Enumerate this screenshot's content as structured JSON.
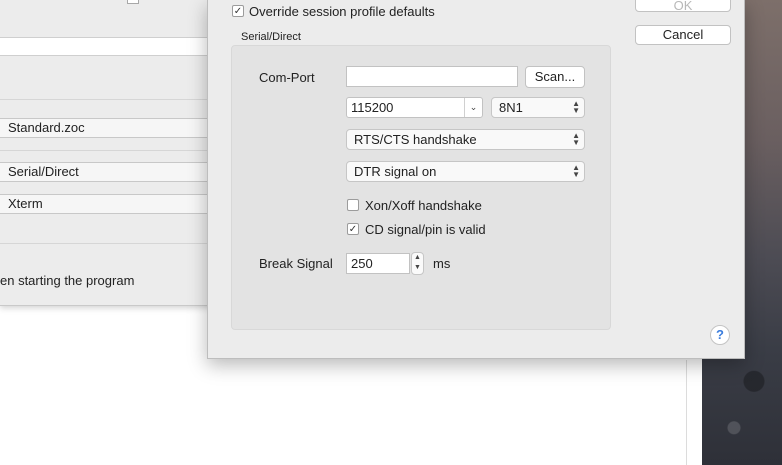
{
  "background_window": {
    "fields": [
      "Standard.zoc",
      "Serial/Direct",
      "Xterm"
    ],
    "partial_text": "en starting the program"
  },
  "sheet": {
    "override_label": "Override session profile defaults",
    "override_checked": "✓",
    "ok_label": "OK",
    "cancel_label": "Cancel",
    "group_title": "Serial/Direct",
    "com_port": {
      "label": "Com-Port",
      "value": "",
      "scan_label": "Scan..."
    },
    "baud": "115200",
    "framing": "8N1",
    "flow_control": "RTS/CTS handshake",
    "dtr": "DTR signal on",
    "xon_xoff": {
      "label": "Xon/Xoff handshake",
      "mark": ""
    },
    "cd_signal": {
      "label": "CD signal/pin is valid",
      "mark": "✓"
    },
    "break_signal": {
      "label": "Break Signal",
      "value": "250",
      "unit": "ms"
    },
    "help_label": "?"
  },
  "colors": {
    "accent": "#3b7ddd",
    "panel": "#ececec",
    "group": "#e3e3e3"
  }
}
